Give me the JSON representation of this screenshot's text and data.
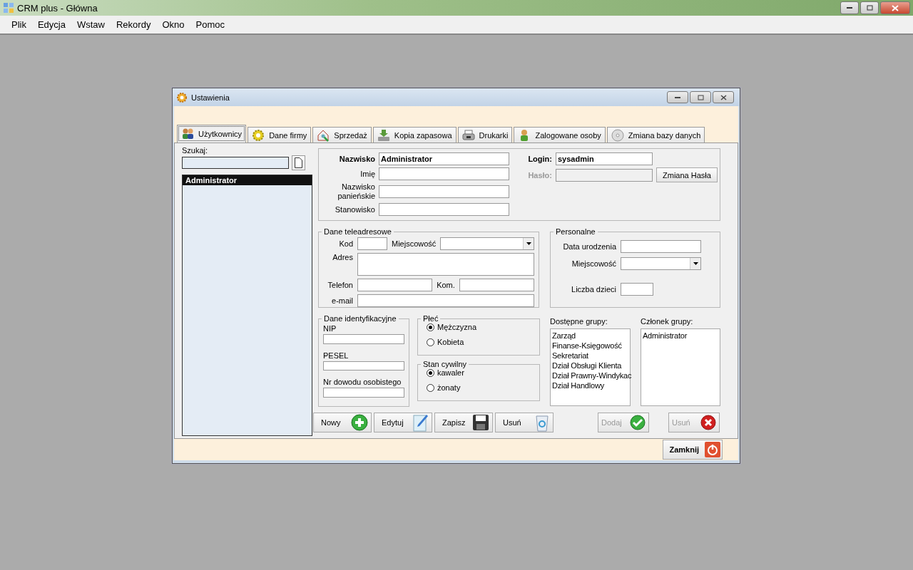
{
  "app": {
    "title": "CRM plus - Główna"
  },
  "menu": [
    {
      "label": "Plik"
    },
    {
      "label": "Edycja"
    },
    {
      "label": "Wstaw"
    },
    {
      "label": "Rekordy"
    },
    {
      "label": "Okno"
    },
    {
      "label": "Pomoc"
    }
  ],
  "dialog": {
    "title": "Ustawienia",
    "tabs": [
      {
        "label": "Użytkownicy",
        "selected": true
      },
      {
        "label": "Dane firmy",
        "selected": false
      },
      {
        "label": "Sprzedaż",
        "selected": false
      },
      {
        "label": "Kopia zapasowa",
        "selected": false
      },
      {
        "label": "Drukarki",
        "selected": false
      },
      {
        "label": "Zalogowane osoby",
        "selected": false
      },
      {
        "label": "Zmiana bazy danych",
        "selected": false
      }
    ],
    "search": {
      "label": "Szukaj:"
    },
    "users": [
      {
        "name": "Administrator",
        "selected": true
      }
    ],
    "person_fields": [
      {
        "label": "Nazwisko",
        "value": "Administrator",
        "bold": true
      },
      {
        "label": "Imię",
        "bold": false
      },
      {
        "label": "Nazwisko panieńskie",
        "bold": false
      },
      {
        "label": "Stanowisko",
        "bold": false
      }
    ],
    "account_fields": [
      {
        "label": "Login:",
        "value": "sysadmin",
        "disabled": false
      },
      {
        "label": "Hasło:",
        "disabled": true
      }
    ],
    "change_password_button": "Zmiana Hasła",
    "contact": {
      "legend": "Dane teleadresowe",
      "rows": [
        [
          {
            "label": "Kod",
            "kind": "short"
          },
          {
            "label": "Miejscowość",
            "kind": "combo"
          }
        ],
        [
          {
            "label": "Adres",
            "kind": "textarea"
          }
        ],
        [
          {
            "label": "Telefon",
            "kind": "text"
          },
          {
            "label": "Kom.",
            "kind": "text"
          }
        ],
        [
          {
            "label": "e-mail",
            "kind": "text"
          }
        ]
      ]
    },
    "personal": {
      "legend": "Personalne",
      "rows": [
        [
          {
            "label": "Data urodzenia",
            "kind": "text"
          }
        ],
        [
          {
            "label": "Miejscowość",
            "kind": "combo"
          }
        ],
        [
          {
            "label": "Liczba dzieci",
            "kind": "short"
          }
        ]
      ]
    },
    "identity": {
      "legend": "Dane identyfikacyjne",
      "fields": [
        {
          "label": "NIP"
        },
        {
          "label": "PESEL"
        },
        {
          "label": "Nr dowodu osobistego"
        }
      ]
    },
    "gender": {
      "legend": "Płeć",
      "options": [
        {
          "label": "Mężczyzna",
          "selected": true
        },
        {
          "label": "Kobieta",
          "selected": false
        }
      ]
    },
    "marital": {
      "legend": "Stan cywilny",
      "options": [
        {
          "label": "kawaler",
          "selected": true
        },
        {
          "label": "żonaty",
          "selected": false
        }
      ]
    },
    "available_groups": {
      "label": "Dostępne grupy:",
      "items": [
        "Zarząd",
        "Finanse-Księgowość",
        "Sekretariat",
        "Dział Obsługi Klienta",
        "Dział Prawny-Windykac",
        "Dział Handlowy"
      ]
    },
    "member_groups": {
      "label": "Członek grupy:",
      "items": [
        "Administrator"
      ]
    },
    "record_buttons": [
      {
        "label": "Nowy",
        "kind": "add"
      },
      {
        "label": "Edytuj",
        "kind": "edit"
      },
      {
        "label": "Zapisz",
        "kind": "save"
      },
      {
        "label": "Usuń",
        "kind": "recycle"
      }
    ],
    "group_buttons": [
      {
        "label": "Dodaj",
        "kind": "ok",
        "disabled": true
      },
      {
        "label": "Usuń",
        "kind": "remove",
        "disabled": true
      }
    ],
    "close_button": {
      "label": "Zamknij"
    }
  }
}
